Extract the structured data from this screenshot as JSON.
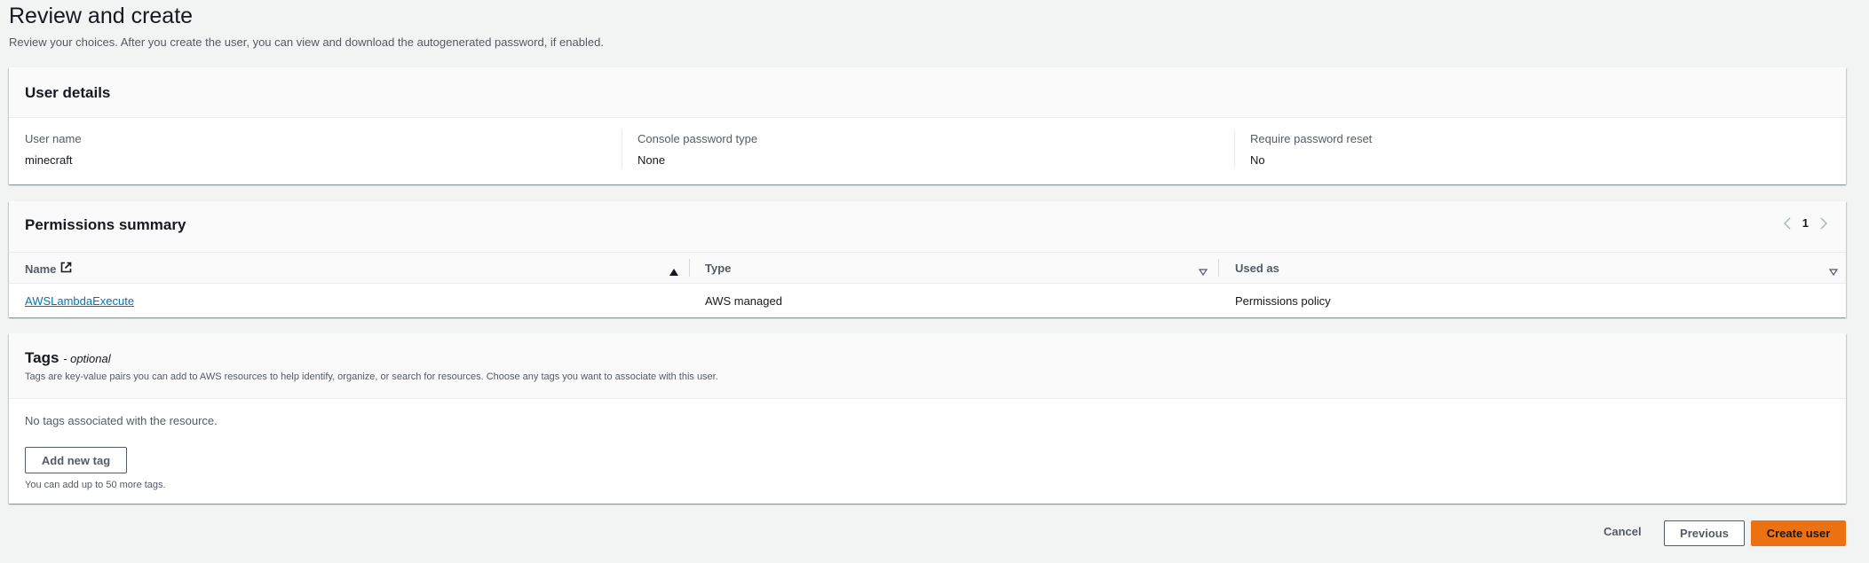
{
  "page": {
    "title": "Review and create",
    "description": "Review your choices. After you create the user, you can view and download the autogenerated password, if enabled."
  },
  "user_details": {
    "title": "User details",
    "fields": [
      {
        "label": "User name",
        "value": "minecraft"
      },
      {
        "label": "Console password type",
        "value": "None"
      },
      {
        "label": "Require password reset",
        "value": "No"
      }
    ]
  },
  "permissions": {
    "title": "Permissions summary",
    "page_number": "1",
    "columns": [
      "Name",
      "Type",
      "Used as"
    ],
    "rows": [
      {
        "name": "AWSLambdaExecute",
        "type": "AWS managed",
        "used_as": "Permissions policy"
      }
    ]
  },
  "tags": {
    "title": "Tags",
    "optional": "- optional",
    "description": "Tags are key-value pairs you can add to AWS resources to help identify, organize, or search for resources. Choose any tags you want to associate with this user.",
    "empty_text": "No tags associated with the resource.",
    "add_button": "Add new tag",
    "hint": "You can add up to 50 more tags."
  },
  "footer": {
    "cancel": "Cancel",
    "previous": "Previous",
    "create": "Create user"
  },
  "colors": {
    "primary": "#ec7211",
    "link": "#0073bb",
    "background": "#f2f3f3"
  }
}
